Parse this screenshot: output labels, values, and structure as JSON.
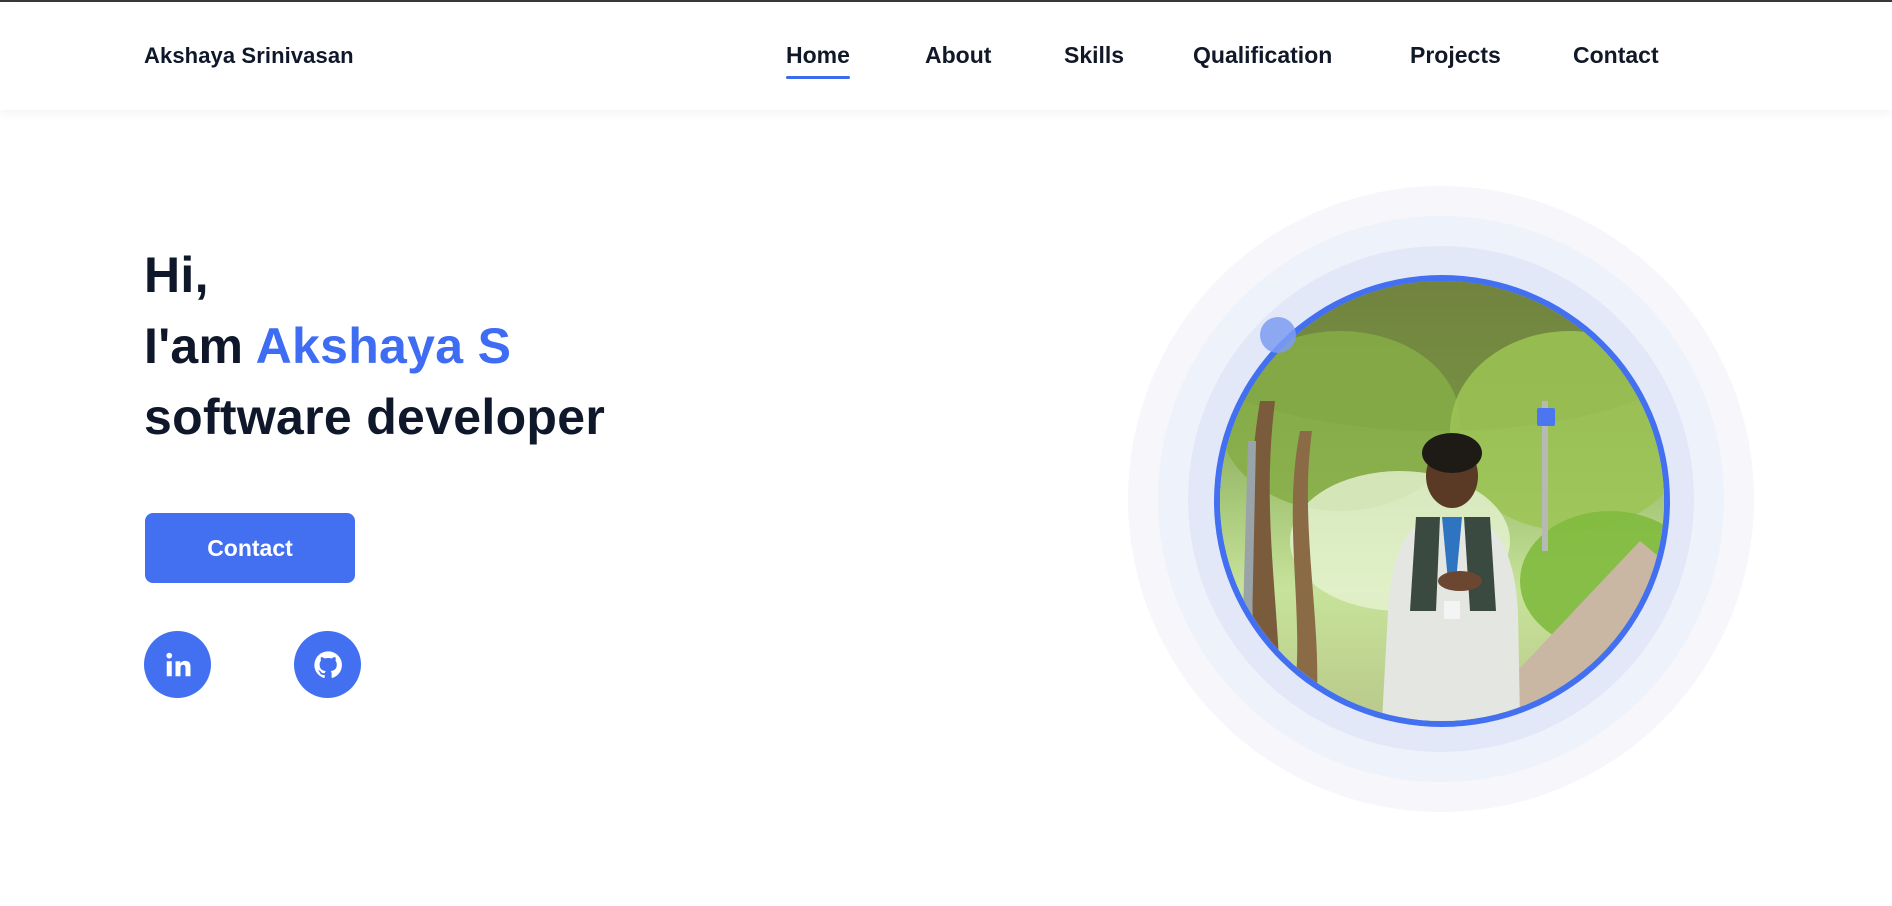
{
  "header": {
    "brand": "Akshaya Srinivasan",
    "nav": [
      {
        "label": "Home",
        "active": true
      },
      {
        "label": "About",
        "active": false
      },
      {
        "label": "Skills",
        "active": false
      },
      {
        "label": "Qualification",
        "active": false
      },
      {
        "label": "Projects",
        "active": false
      },
      {
        "label": "Contact",
        "active": false
      }
    ]
  },
  "hero": {
    "greeting": "Hi,",
    "intro_prefix": "I'am",
    "name": "Akshaya S",
    "role": "software developer",
    "contact_button": "Contact",
    "social": [
      {
        "icon": "linkedin-icon"
      },
      {
        "icon": "github-icon"
      }
    ]
  },
  "colors": {
    "accent": "#3e6cf2",
    "button": "#4370f1",
    "text": "#0f172a"
  }
}
